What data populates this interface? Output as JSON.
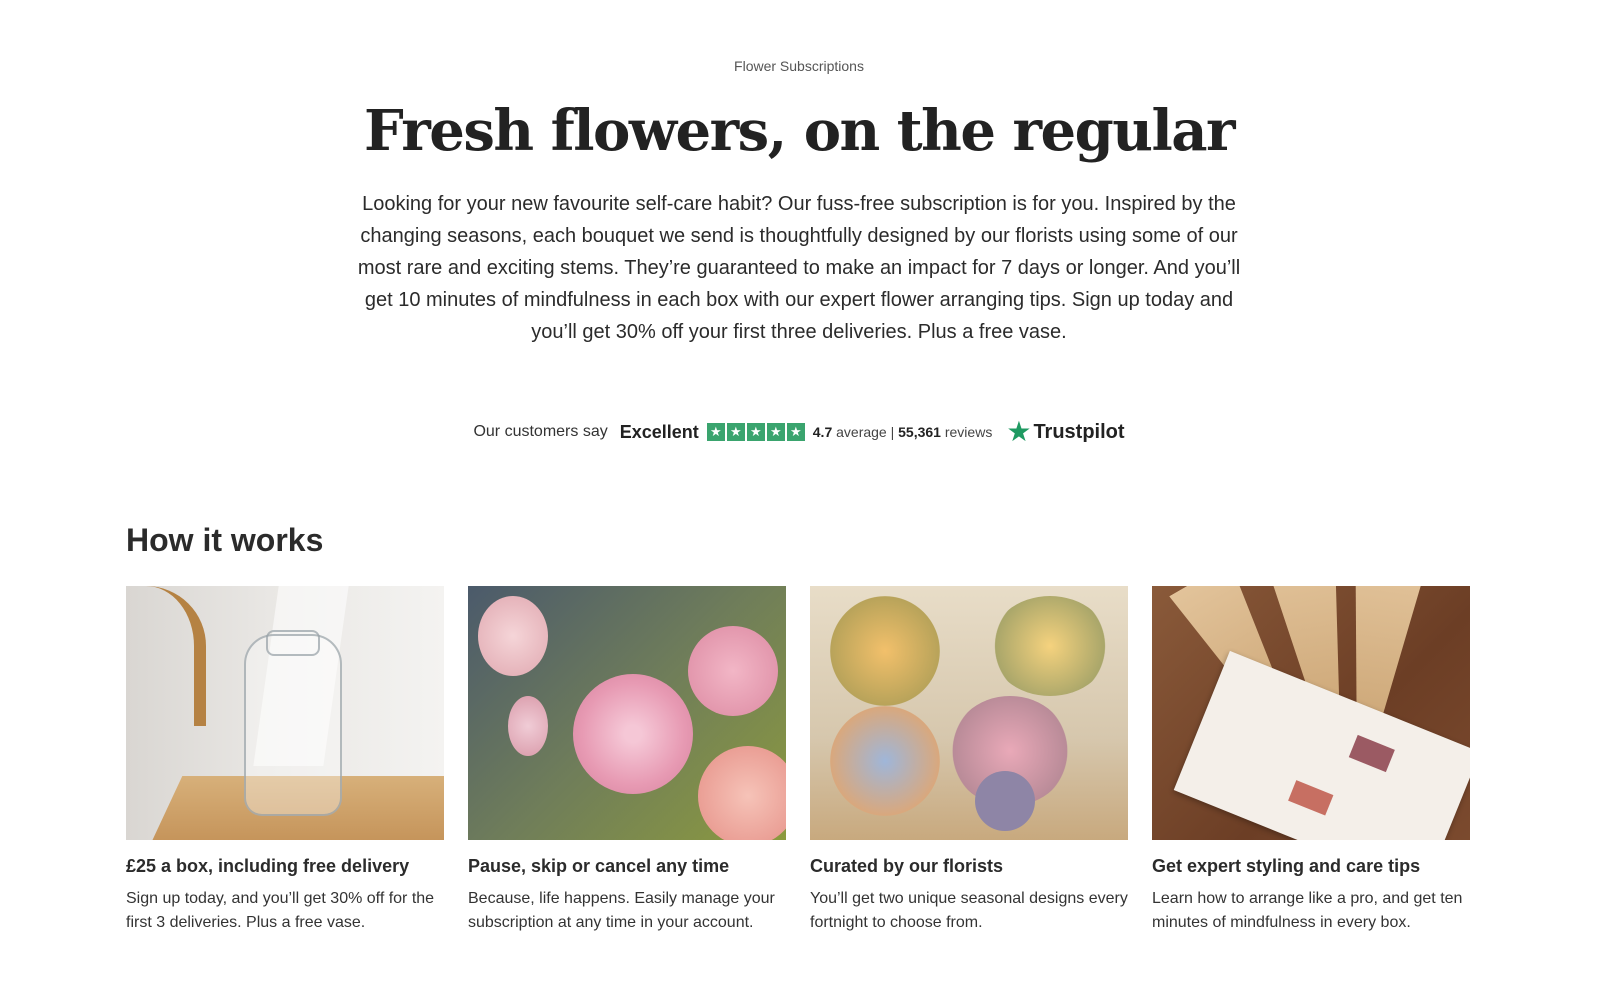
{
  "hero": {
    "eyebrow": "Flower Subscriptions",
    "title": "Fresh flowers, on the regular",
    "intro": "Looking for your new favourite self-care habit? Our fuss-free subscription is for you. Inspired by the changing seasons, each bouquet we send is thoughtfully designed by our florists using some of our most rare and exciting stems. They’re guaranteed to make an impact for 7 days or longer. And you’ll get 10 minutes of mindfulness in each box with our expert flower arranging tips. Sign up today and you’ll get 30% off your first three deliveries. Plus a free vase."
  },
  "trustpilot": {
    "lead": "Our customers say",
    "rating_word": "Excellent",
    "stars": 5,
    "star_glyph": "★",
    "average": "4.7",
    "average_label": "average",
    "separator": "|",
    "reviews_count": "55,361",
    "reviews_label": "reviews",
    "brand": "Trustpilot",
    "brand_color": "#1f9a62",
    "star_color": "#3aa46e"
  },
  "how_it_works": {
    "title": "How it works",
    "cards": [
      {
        "title": "£25 a box, including free delivery",
        "text": "Sign up today, and you’ll get 30% off for the first 3 deliveries. Plus a free vase."
      },
      {
        "title": "Pause, skip or cancel any time",
        "text": "Because, life happens. Easily manage your subscription at any time in your account."
      },
      {
        "title": "Curated by our florists",
        "text": "You’ll get two unique seasonal designs every fortnight to choose from."
      },
      {
        "title": "Get expert styling and care tips",
        "text": "Learn how to arrange like a pro, and get ten minutes of mindfulness in every box."
      }
    ]
  }
}
